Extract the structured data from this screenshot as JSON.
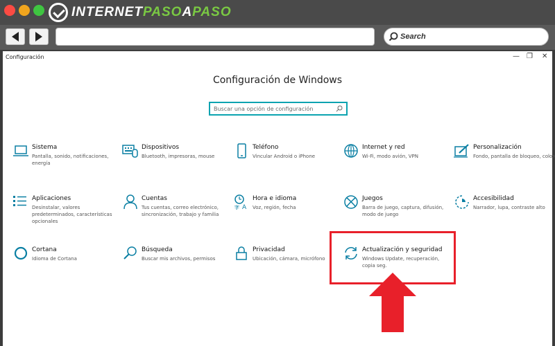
{
  "browser": {
    "logo_text_a": "INTERNET",
    "logo_text_b": "PASO",
    "logo_text_c": "A",
    "logo_text_d": "PASO",
    "search_label": "Search"
  },
  "window": {
    "title": "Configuración",
    "minimize": "—",
    "maximize": "❐",
    "close": "✕"
  },
  "main": {
    "title": "Configuración de Windows",
    "search_placeholder": "Buscar una opción de configuración"
  },
  "tiles": [
    {
      "name": "Sistema",
      "desc": "Pantalla, sonido, notificaciones, energía",
      "icon": "laptop-icon"
    },
    {
      "name": "Dispositivos",
      "desc": "Bluetooth, impresoras, mouse",
      "icon": "keyboard-icon"
    },
    {
      "name": "Teléfono",
      "desc": "Vincular Android o iPhone",
      "icon": "phone-icon"
    },
    {
      "name": "Internet y red",
      "desc": "Wi-Fi, modo avión, VPN",
      "icon": "globe-icon"
    },
    {
      "name": "Personalización",
      "desc": "Fondo, pantalla de bloqueo, colores",
      "icon": "paint-icon"
    },
    {
      "name": "Aplicaciones",
      "desc": "Desinstalar, valores predeterminados, características opcionales",
      "icon": "apps-list-icon"
    },
    {
      "name": "Cuentas",
      "desc": "Tus cuentas, correo electrónico, sincronización, trabajo y familia",
      "icon": "person-icon"
    },
    {
      "name": "Hora e idioma",
      "desc": "Voz, región, fecha",
      "icon": "time-language-icon"
    },
    {
      "name": "Juegos",
      "desc": "Barra de juego, captura, difusión, modo de juego",
      "icon": "xbox-icon"
    },
    {
      "name": "Accesibilidad",
      "desc": "Narrador, lupa, contraste alto",
      "icon": "accessibility-icon"
    },
    {
      "name": "Cortana",
      "desc": "Idioma de Cortana",
      "icon": "cortana-icon"
    },
    {
      "name": "Búsqueda",
      "desc": "Buscar mis archivos, permisos",
      "icon": "search-icon"
    },
    {
      "name": "Privacidad",
      "desc": "Ubicación, cámara, micrófono",
      "icon": "lock-icon"
    },
    {
      "name": "Actualización y seguridad",
      "desc": "Windows Update, recuperación, copia seg.",
      "icon": "sync-icon"
    }
  ],
  "colors": {
    "accent": "#0a7fa3",
    "highlight": "#e8202a"
  }
}
